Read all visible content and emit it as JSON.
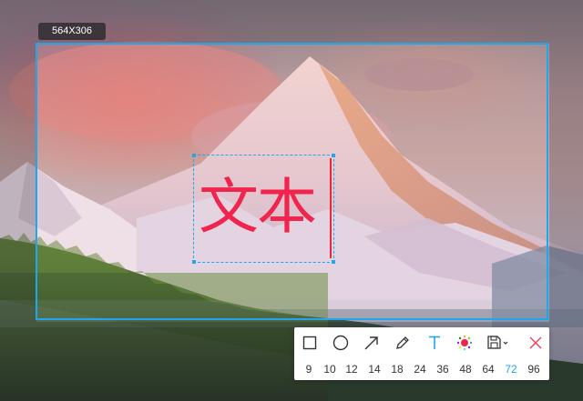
{
  "selection": {
    "size_label": "564X306"
  },
  "text_tool": {
    "content": "文本",
    "color": "#f0244c"
  },
  "toolbar": {
    "tools": [
      {
        "name": "rectangle",
        "icon": "square-icon"
      },
      {
        "name": "ellipse",
        "icon": "circle-icon"
      },
      {
        "name": "arrow",
        "icon": "arrow-icon"
      },
      {
        "name": "pen",
        "icon": "pencil-icon"
      },
      {
        "name": "text",
        "icon": "text-icon",
        "active": true
      },
      {
        "name": "color",
        "icon": "color-picker-icon"
      },
      {
        "name": "save",
        "icon": "save-icon"
      },
      {
        "name": "close",
        "icon": "close-icon"
      }
    ],
    "font_sizes": [
      "9",
      "10",
      "12",
      "14",
      "18",
      "24",
      "36",
      "48",
      "64",
      "72",
      "96"
    ],
    "selected_font_size": "72"
  },
  "colors": {
    "accent": "#1ea6ee",
    "text_color": "#f0244c",
    "close_color": "#e84a5f"
  }
}
